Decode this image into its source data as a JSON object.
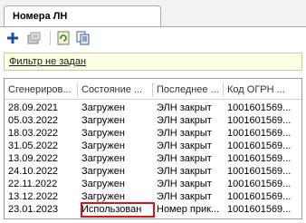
{
  "tab": {
    "title": "Номера ЛН"
  },
  "toolbar": {
    "buttons": [
      {
        "name": "add-button",
        "icon": "plus-icon"
      },
      {
        "name": "edit-button",
        "icon": "edit-icon"
      },
      {
        "name": "refresh-button",
        "icon": "refresh-icon"
      },
      {
        "name": "copy-button",
        "icon": "copy-icon"
      }
    ]
  },
  "filter": {
    "text": "Фильтр не задан"
  },
  "grid": {
    "columns": [
      "Сгенериров...",
      "Состояние ...",
      "Последнее ...",
      "Код ОГРН ..."
    ],
    "rows": [
      [
        "28.09.2021",
        "Загружен",
        "ЭЛН закрыт",
        "1001601569..."
      ],
      [
        "05.03.2022",
        "Загружен",
        "ЭЛН закрыт",
        "1001601569..."
      ],
      [
        "18.03.2022",
        "Загружен",
        "ЭЛН закрыт",
        "1001601569..."
      ],
      [
        "31.05.2022",
        "Загружен",
        "ЭЛН закрыт",
        "1001601569..."
      ],
      [
        "13.09.2022",
        "Загружен",
        "ЭЛН закрыт",
        "1001601569..."
      ],
      [
        "24.10.2022",
        "Загружен",
        "ЭЛН закрыт",
        "1001601569..."
      ],
      [
        "22.11.2022",
        "Загружен",
        "ЭЛН закрыт",
        "1001601569..."
      ],
      [
        "13.12.2022",
        "Загружен",
        "ЭЛН закрыт",
        "1001601569..."
      ],
      [
        "23.01.2023",
        "Использован",
        "Номер прик...",
        "1001601569..."
      ]
    ]
  },
  "colors": {
    "accent_highlight": "#e0101a",
    "filter_bg": "#fefee2",
    "plus": "#1b4fa8"
  }
}
